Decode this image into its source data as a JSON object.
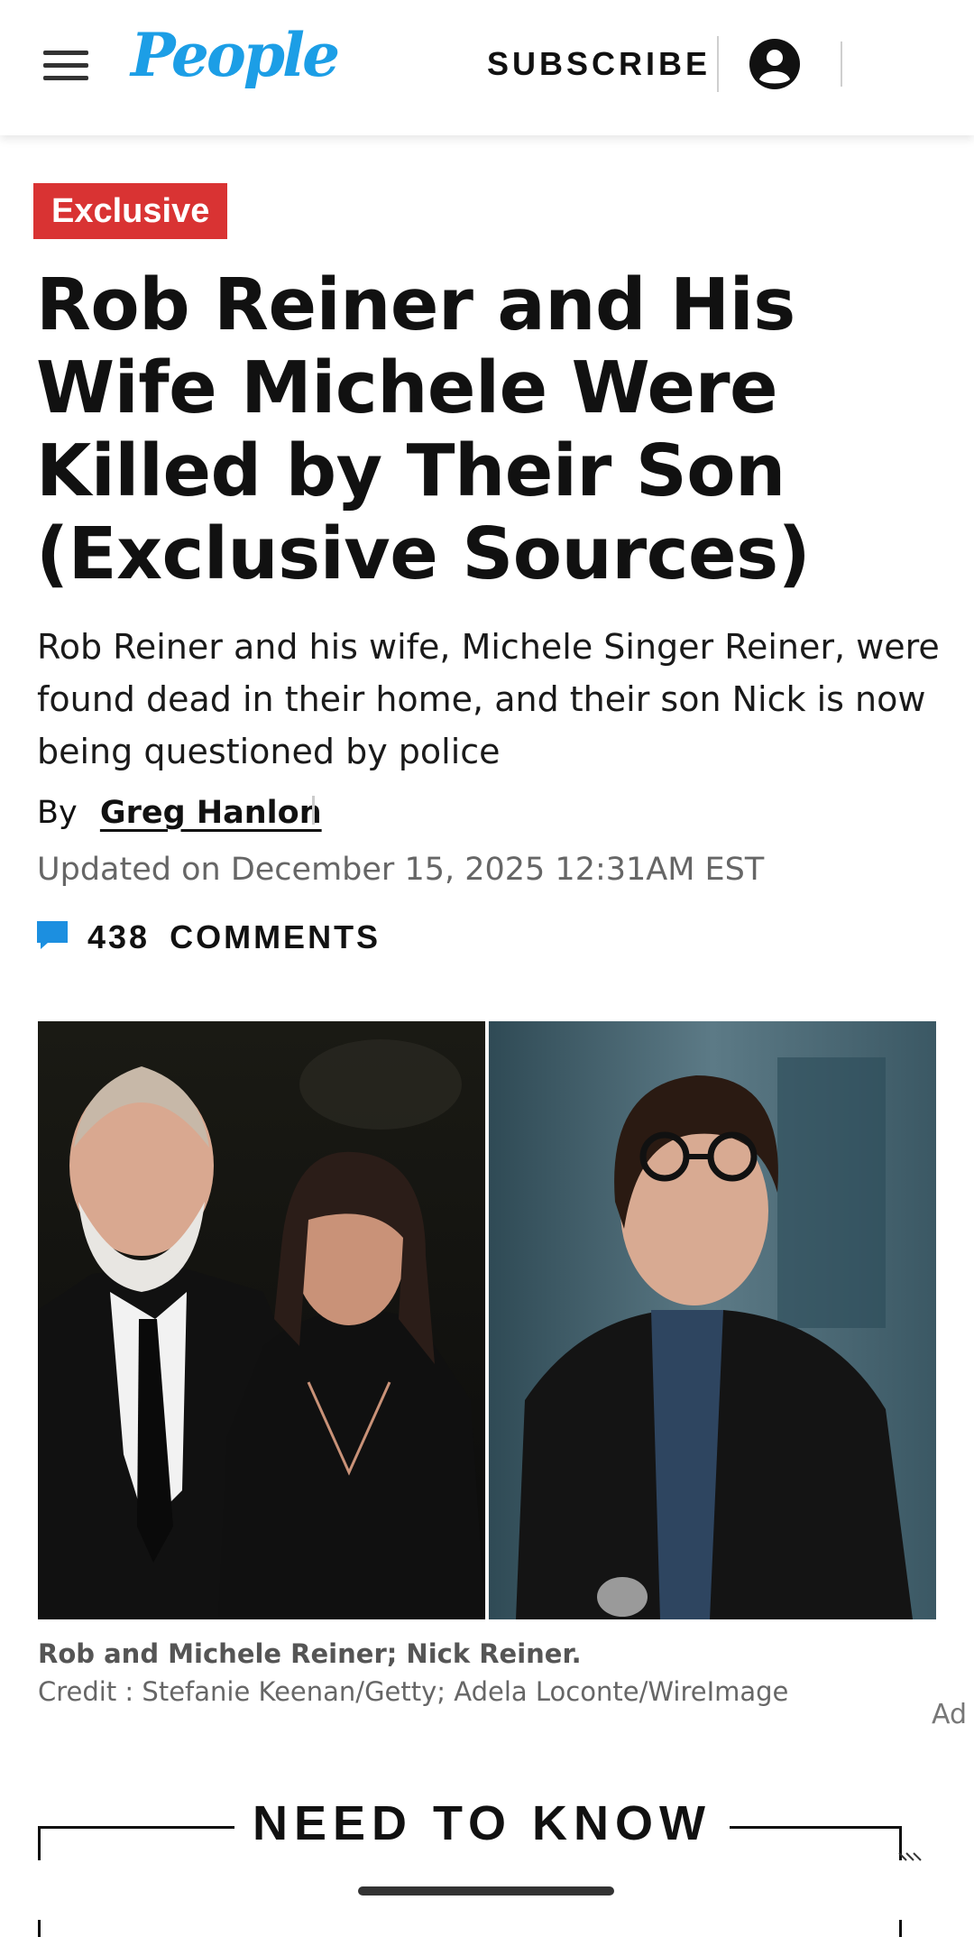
{
  "header": {
    "logo": "People",
    "subscribe_label": "SUBSCRIBE"
  },
  "article": {
    "tag": "Exclusive",
    "headline": "Rob Reiner and His Wife Michele Were Killed by Their Son (Exclusive Sources)",
    "dek": "Rob Reiner and his wife, Michele Singer Reiner, were found dead in their home, and their son Nick is now being questioned by police",
    "byline_prefix": "By",
    "author": "Greg Hanlon",
    "updated": "Updated on December 15, 2025 12:31AM EST",
    "comments_count": "438",
    "comments_label": "COMMENTS",
    "image_caption": "Rob and Michele Reiner; Nick Reiner.",
    "image_credit": "Credit : Stefanie Keenan/Getty; Adela Loconte/WireImage"
  },
  "ad_label": "Ad",
  "need_to_know": {
    "title": "NEED TO KNOW"
  },
  "colors": {
    "brand": "#1c9ee6",
    "tag_red": "#d93333",
    "comment_icon": "#1c8fe0"
  },
  "icons": [
    "hamburger-menu-icon",
    "account-icon",
    "comment-icon"
  ]
}
